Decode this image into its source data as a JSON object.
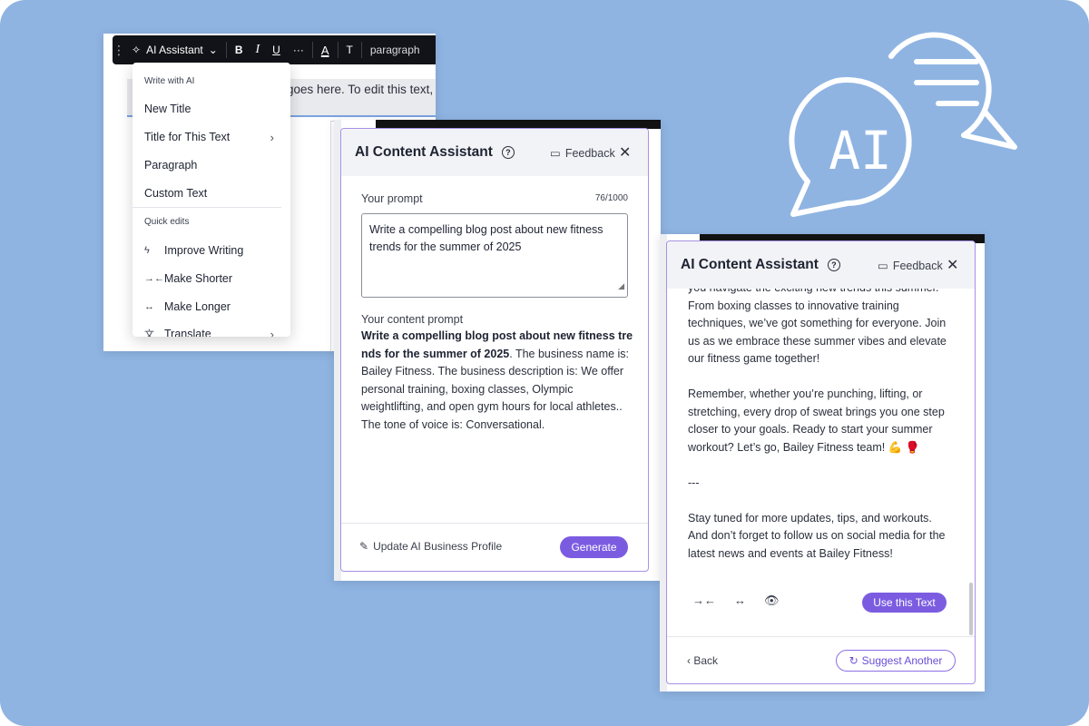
{
  "colors": {
    "background": "#8fb4e2",
    "accent": "#7b5ce1",
    "panel_border": "#a891e6"
  },
  "graphic": {
    "label": "AI",
    "icon": "ai-chat-bubbles-icon"
  },
  "editor": {
    "selected_text": "goes here. To edit this text, c",
    "toolbar": {
      "ai_assistant": "AI Assistant",
      "bold": "B",
      "italic": "I",
      "underline": "U",
      "more": "···",
      "text_color": "A",
      "clear_format": "T",
      "paragraph": "paragraph"
    },
    "menu": {
      "write_section": "Write with AI",
      "write_items": [
        "New Title",
        "Title for This Text",
        "Paragraph",
        "Custom Text"
      ],
      "quick_section": "Quick edits",
      "quick_items": [
        "Improve Writing",
        "Make Shorter",
        "Make Longer",
        "Translate"
      ]
    }
  },
  "panel_prompt": {
    "title": "AI Content Assistant",
    "feedback": "Feedback",
    "prompt_label": "Your prompt",
    "char_count": "76/1000",
    "prompt_value": "Write a compelling blog post about new fitness trends for the summer of 2025",
    "content_prompt_label": "Your content prompt",
    "content_prompt_bold": "Write a compelling blog post about new fitness tre nds for the summer of 2025",
    "content_prompt_rest": ". The business name is: Bailey Fitness. The business description is: We offer personal training, boxing classes, Olympic weightlifting, and open gym hours for local athletes.. The tone of voice is: Conversational.",
    "update_profile": "Update AI Business Profile",
    "generate": "Generate"
  },
  "panel_result": {
    "title": "AI Content Assistant",
    "feedback": "Feedback",
    "paragraphs": [
      "you navigate the exciting new trends this summer. From boxing classes to innovative training techniques, we’ve got something for everyone. Join us as we embrace these summer vibes and elevate our fitness game together!",
      "Remember, whether you’re punching, lifting, or stretching, every drop of sweat brings you one step closer to your goals. Ready to start your summer workout? Let’s go, Bailey Fitness team! 💪 🥊",
      "---",
      "Stay tuned for more updates, tips, and workouts. And don’t forget to follow us on social media for the latest news and events at Bailey Fitness!"
    ],
    "use_text": "Use this Text",
    "back": "Back",
    "suggest_another": "Suggest Another"
  }
}
